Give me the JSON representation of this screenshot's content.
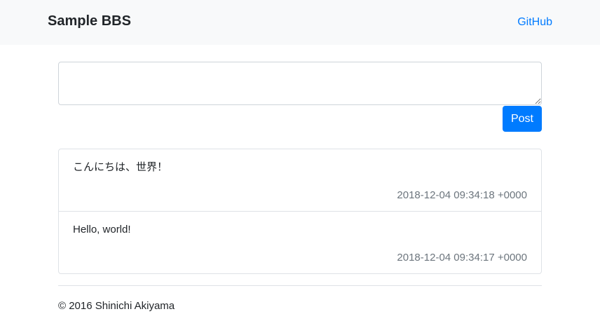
{
  "navbar": {
    "brand": "Sample BBS",
    "link": "GitHub"
  },
  "form": {
    "textarea_value": "",
    "submit_label": "Post"
  },
  "posts": [
    {
      "body": "こんにちは、世界！",
      "timestamp": "2018-12-04 09:34:18 +0000"
    },
    {
      "body": "Hello, world!",
      "timestamp": "2018-12-04 09:34:17 +0000"
    }
  ],
  "footer": {
    "copyright": "© 2016 Shinichi Akiyama"
  },
  "colors": {
    "accent": "#007bff",
    "navbar_bg": "#f8f9fa",
    "muted_text": "#6c757d"
  }
}
